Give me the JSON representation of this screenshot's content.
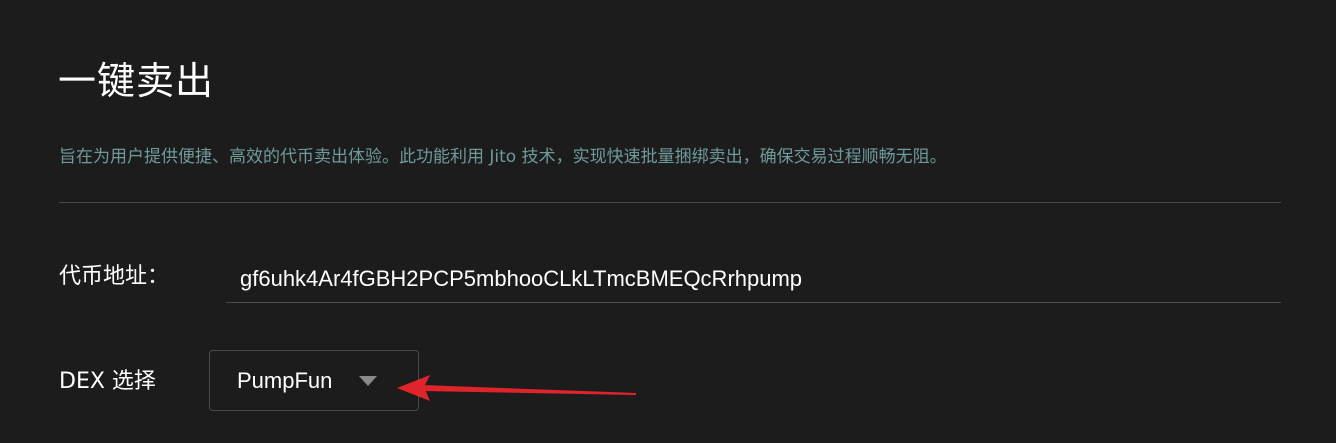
{
  "header": {
    "title": "一键卖出",
    "description": "旨在为用户提供便捷、高效的代币卖出体验。此功能利用 Jito 技术，实现快速批量捆绑卖出，确保交易过程顺畅无阻。"
  },
  "form": {
    "token_address": {
      "label": "代币地址：",
      "value": "gf6uhk4Ar4fGBH2PCP5mbhooCLkLTmcBMEQcRrhpump"
    },
    "dex": {
      "label": "DEX 选择",
      "selected": "PumpFun"
    }
  },
  "colors": {
    "background": "#1c1c1c",
    "description_text": "#6e9a9a",
    "annotation_arrow": "#e0242b"
  }
}
